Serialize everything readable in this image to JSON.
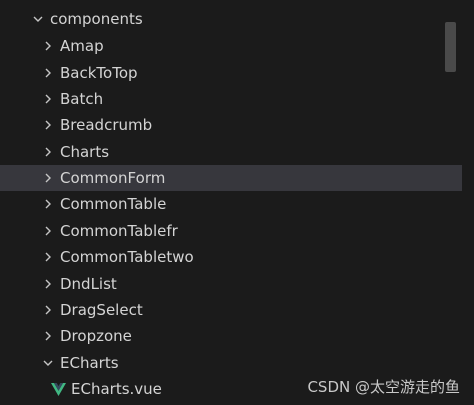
{
  "tree": {
    "root": {
      "label": "components",
      "icon": "chevron-down-icon",
      "expanded": true
    },
    "folders": [
      {
        "label": "Amap",
        "icon": "chevron-right-icon"
      },
      {
        "label": "BackToTop",
        "icon": "chevron-right-icon"
      },
      {
        "label": "Batch",
        "icon": "chevron-right-icon"
      },
      {
        "label": "Breadcrumb",
        "icon": "chevron-right-icon"
      },
      {
        "label": "Charts",
        "icon": "chevron-right-icon"
      },
      {
        "label": "CommonForm",
        "icon": "chevron-right-icon",
        "selected": true
      },
      {
        "label": "CommonTable",
        "icon": "chevron-right-icon"
      },
      {
        "label": "CommonTablefr",
        "icon": "chevron-right-icon"
      },
      {
        "label": "CommonTabletwo",
        "icon": "chevron-right-icon"
      },
      {
        "label": "DndList",
        "icon": "chevron-right-icon"
      },
      {
        "label": "DragSelect",
        "icon": "chevron-right-icon"
      },
      {
        "label": "Dropzone",
        "icon": "chevron-right-icon"
      },
      {
        "label": "ECharts",
        "icon": "chevron-down-icon",
        "expanded": true
      }
    ],
    "files": [
      {
        "label": "ECharts.vue",
        "icon": "vue-icon"
      }
    ]
  },
  "watermark": "CSDN @太空游走的鱼",
  "colors": {
    "background": "#1b1b1b",
    "selected_row": "#37373d",
    "text": "#d4d4d4",
    "vue_green": "#41b883",
    "vue_dark": "#35495e"
  }
}
